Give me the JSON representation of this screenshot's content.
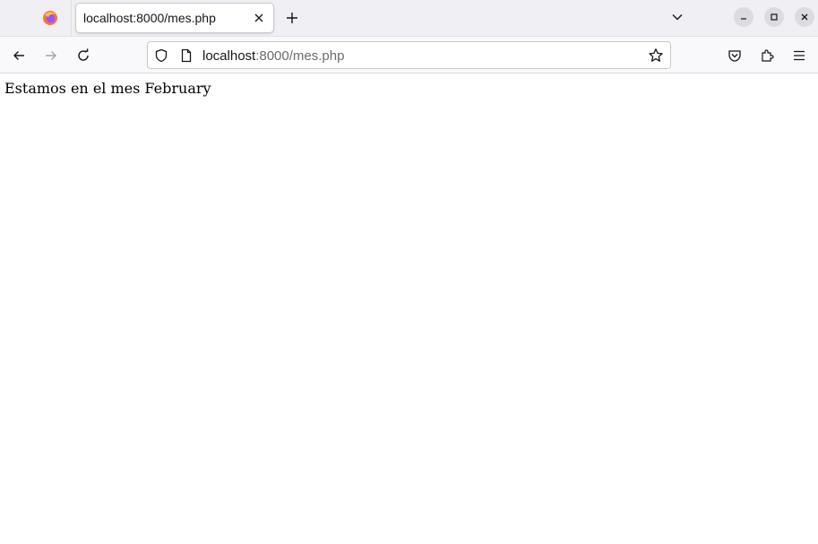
{
  "browser": {
    "tab": {
      "title": "localhost:8000/mes.php"
    },
    "url": {
      "host": "localhost",
      "rest": ":8000/mes.php"
    },
    "icons": {
      "app": "firefox-icon",
      "tab_close": "close-icon",
      "new_tab": "plus-icon",
      "tab_list": "chevron-down-icon",
      "minimize": "minimize-icon",
      "maximize": "maximize-icon",
      "close_window": "close-window-icon",
      "back": "back-arrow-icon",
      "forward": "forward-arrow-icon",
      "reload": "reload-icon",
      "shield": "shield-icon",
      "page": "page-icon",
      "bookmark": "star-icon",
      "pocket": "pocket-icon",
      "extensions": "extensions-icon",
      "menu": "hamburger-menu-icon"
    }
  },
  "page": {
    "text": "Estamos en el mes February"
  },
  "colors": {
    "tabstrip_bg": "#f0f0f4",
    "navbar_bg": "#f9f9fb",
    "firefox_orange": "#ff7139",
    "firefox_purple": "#9059ff"
  }
}
